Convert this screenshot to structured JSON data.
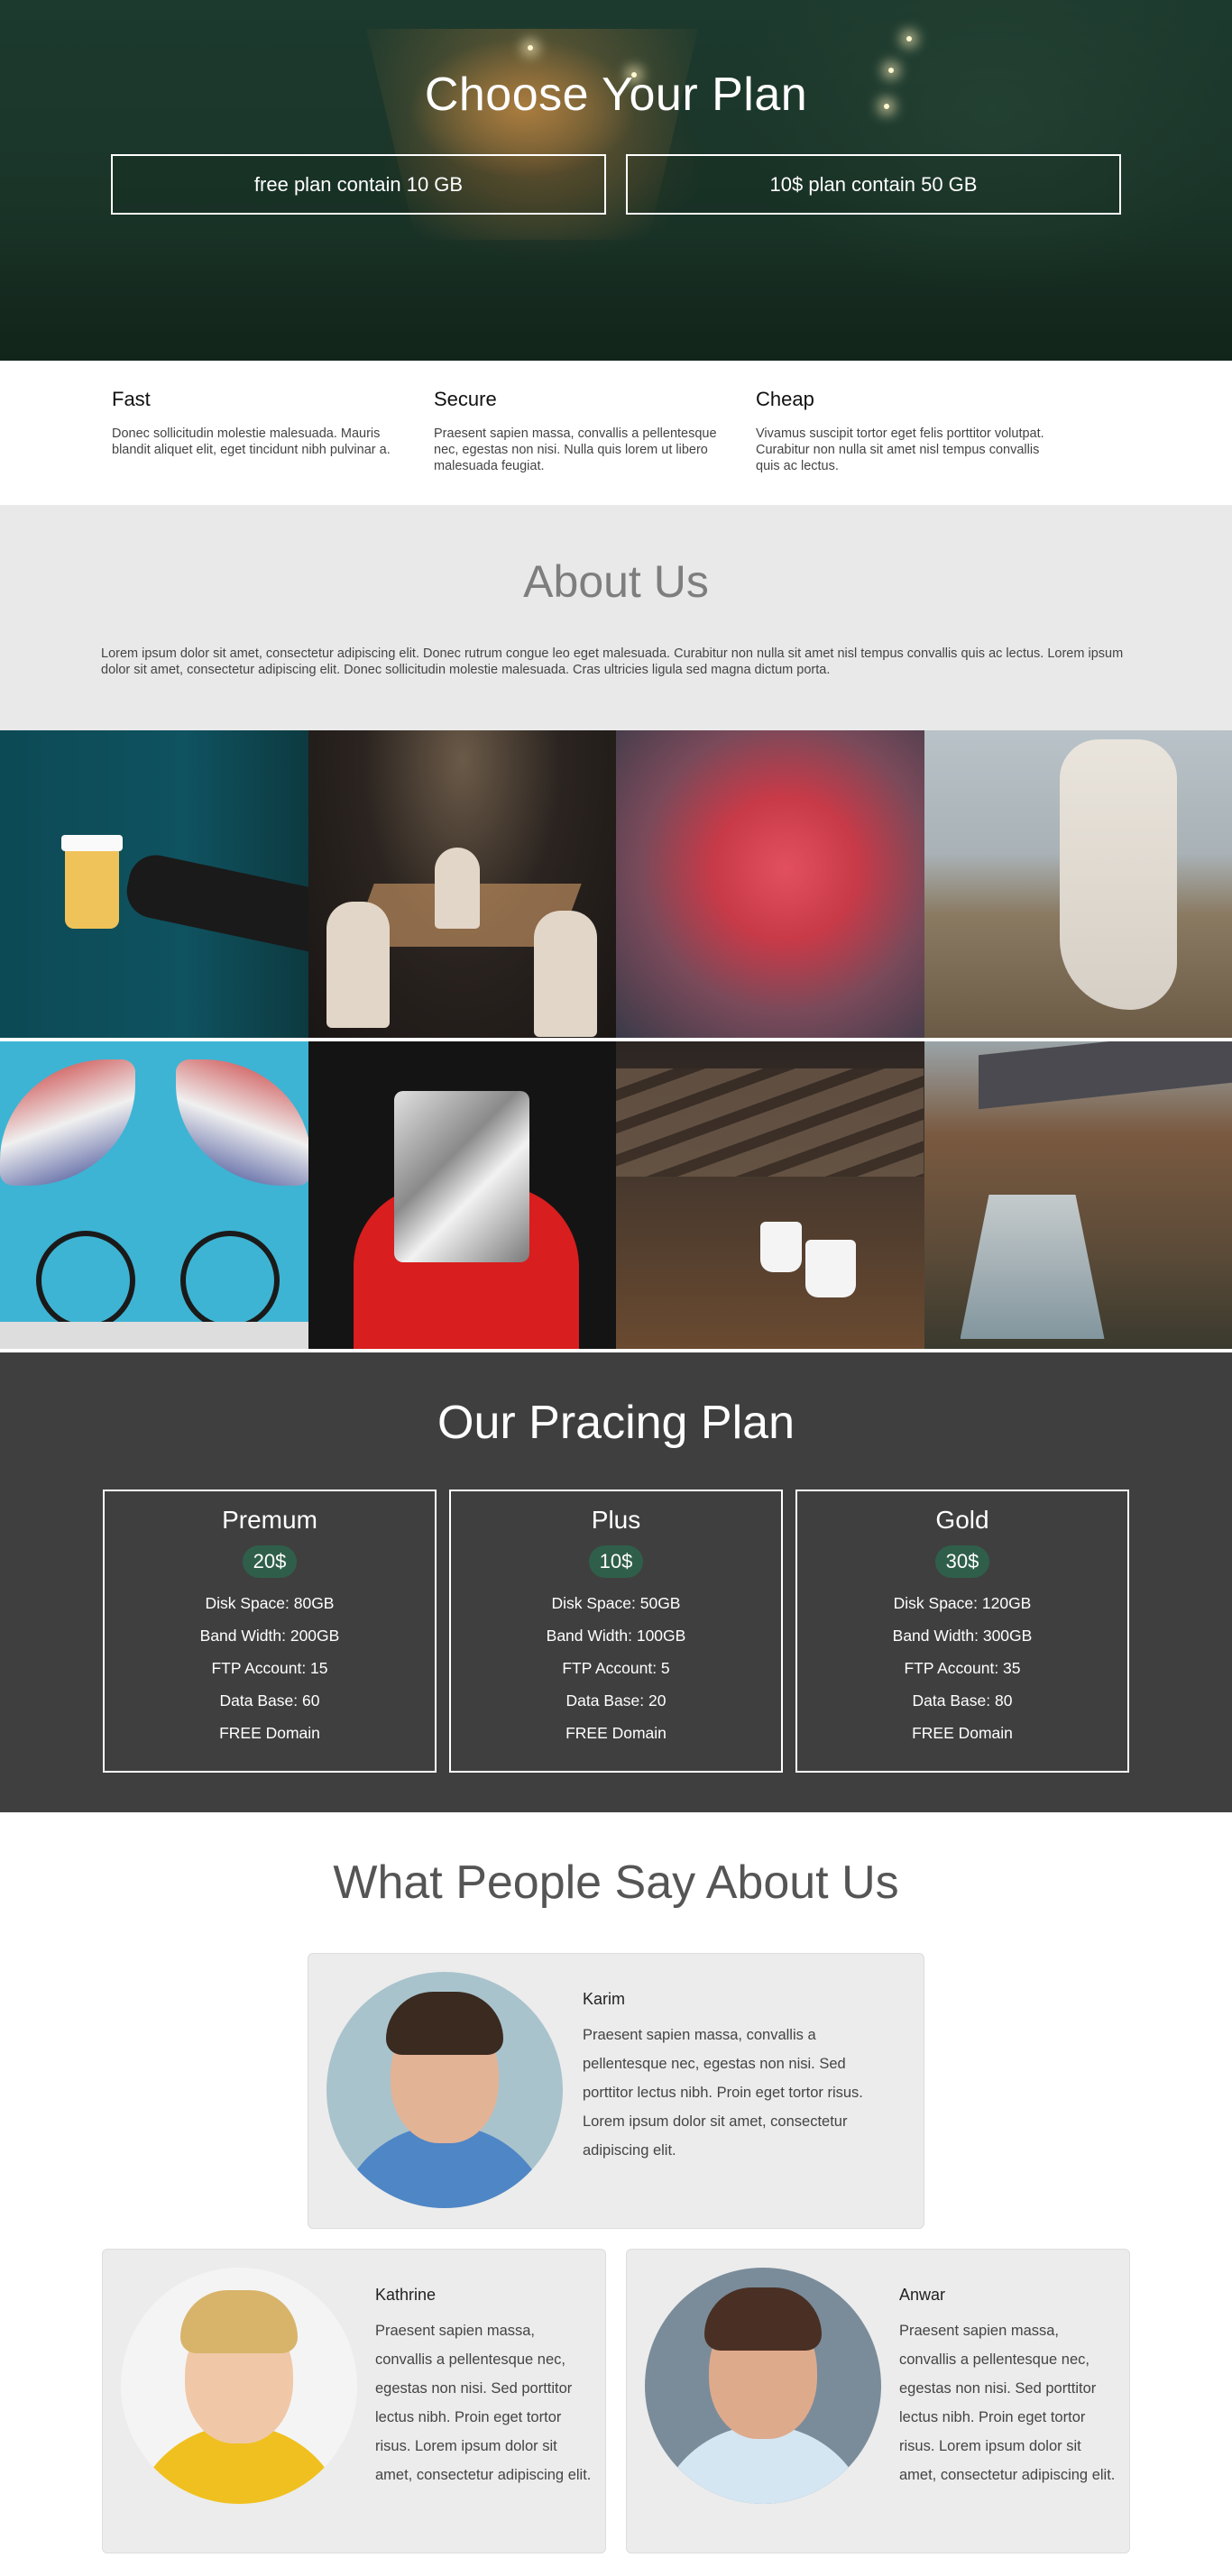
{
  "hero": {
    "title": "Choose Your Plan",
    "plan_free": "free plan contain 10 GB",
    "plan_paid": "10$ plan contain 50 GB"
  },
  "features": [
    {
      "title": "Fast",
      "text": "Donec sollicitudin molestie malesuada. Mauris blandit aliquet elit, eget tincidunt nibh pulvinar a."
    },
    {
      "title": "Secure",
      "text": "Praesent sapien massa, convallis a pellentesque nec, egestas non nisi. Nulla quis lorem ut libero malesuada feugiat."
    },
    {
      "title": "Cheap",
      "text": "Vivamus suscipit tortor eget felis porttitor volutpat. Curabitur non nulla sit amet nisl tempus convallis quis ac lectus."
    }
  ],
  "about": {
    "title": "About Us",
    "text": "Lorem ipsum dolor sit amet, consectetur adipiscing elit. Donec rutrum congue leo eget malesuada. Curabitur non nulla sit amet nisl tempus convallis quis ac lectus. Lorem ipsum dolor sit amet, consectetur adipiscing elit. Donec sollicitudin molestie malesuada. Cras ultricies ligula sed magna dictum porta."
  },
  "pricing": {
    "title": "Our Pracing Plan",
    "plans": [
      {
        "name": "Premum",
        "price": "20$",
        "features": [
          "Disk Space: 80GB",
          "Band Width: 200GB",
          "FTP Account: 15",
          "Data Base: 60",
          "FREE Domain"
        ]
      },
      {
        "name": "Plus",
        "price": "10$",
        "features": [
          "Disk Space: 50GB",
          "Band Width: 100GB",
          "FTP Account: 5",
          "Data Base: 20",
          "FREE Domain"
        ]
      },
      {
        "name": "Gold",
        "price": "30$",
        "features": [
          "Disk Space: 120GB",
          "Band Width: 300GB",
          "FTP Account: 35",
          "Data Base: 80",
          "FREE Domain"
        ]
      }
    ]
  },
  "testimonials": {
    "title": "What People Say About Us",
    "items": [
      {
        "name": "Karim",
        "text": "Praesent sapien massa, convallis a pellentesque nec, egestas non nisi. Sed porttitor lectus nibh. Proin eget tortor risus. Lorem ipsum dolor sit amet, consectetur adipiscing elit."
      },
      {
        "name": "Kathrine",
        "text": "Praesent sapien massa, convallis a pellentesque nec, egestas non nisi. Sed porttitor lectus nibh. Proin eget tortor risus. Lorem ipsum dolor sit amet, consectetur adipiscing elit."
      },
      {
        "name": "Anwar",
        "text": "Praesent sapien massa, convallis a pellentesque nec, egestas non nisi. Sed porttitor lectus nibh. Proin eget tortor risus. Lorem ipsum dolor sit amet, consectetur adipiscing elit."
      }
    ]
  },
  "colors": {
    "hero_green": "#1d3a2e",
    "price_badge": "#2f5f4a",
    "pricing_bg": "#3f3f3f",
    "about_bg": "#e9e9e9"
  }
}
